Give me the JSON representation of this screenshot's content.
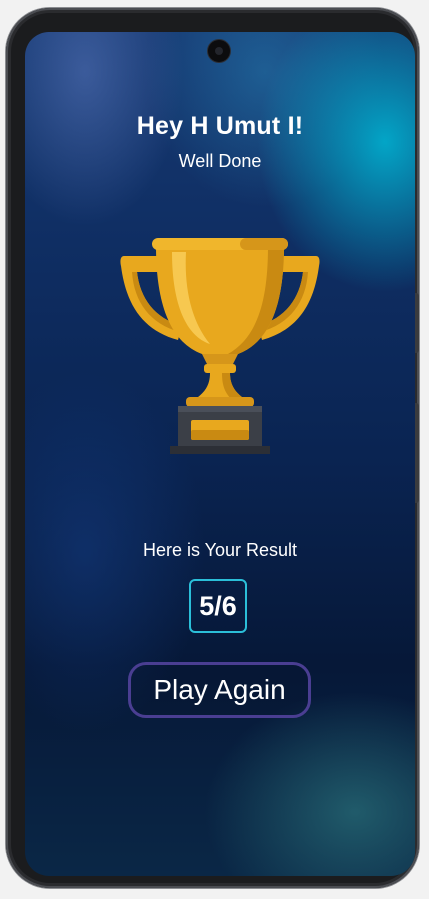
{
  "header": {
    "greeting": "Hey H Umut I!",
    "message": "Well Done"
  },
  "trophy": {
    "icon": "trophy-icon",
    "colors": {
      "gold": "#e8a81e",
      "gold_dark": "#c98a12",
      "gold_light": "#f7c850",
      "base": "#3b3f47"
    }
  },
  "result": {
    "label": "Here is Your Result",
    "score": "5/6"
  },
  "actions": {
    "play_again_label": "Play Again"
  },
  "colors": {
    "score_border": "#2bbfd9",
    "button_border": "#4a3e92",
    "text": "#ffffff"
  }
}
